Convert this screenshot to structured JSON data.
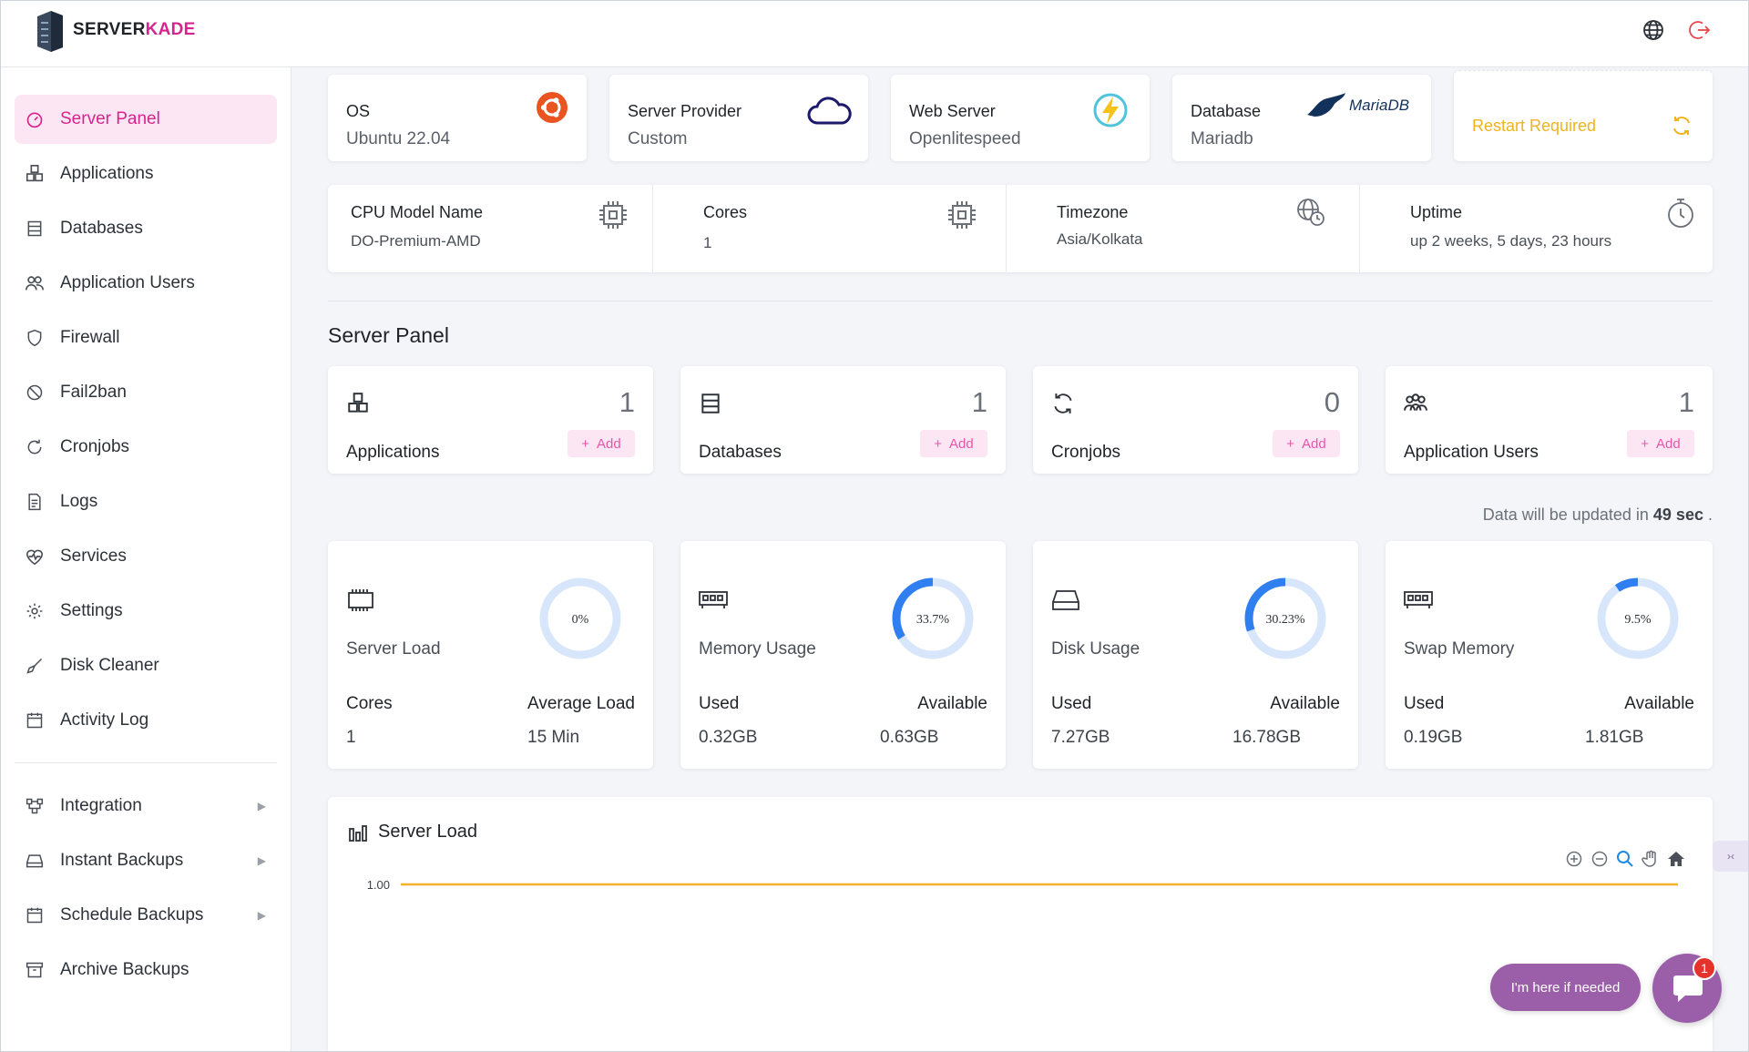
{
  "brand": {
    "part1": "SERVER",
    "part2": "KADE",
    "accent": "#d6248f"
  },
  "header": {
    "icons": [
      "globe-icon",
      "logout-icon"
    ]
  },
  "sidebar": {
    "items": [
      {
        "label": "Server Panel",
        "icon": "speedometer-icon",
        "active": true
      },
      {
        "label": "Applications",
        "icon": "cubes-icon"
      },
      {
        "label": "Databases",
        "icon": "database-icon"
      },
      {
        "label": "Application Users",
        "icon": "users-icon"
      },
      {
        "label": "Firewall",
        "icon": "shield-icon"
      },
      {
        "label": "Fail2ban",
        "icon": "ban-icon"
      },
      {
        "label": "Cronjobs",
        "icon": "refresh-icon"
      },
      {
        "label": "Logs",
        "icon": "document-icon"
      },
      {
        "label": "Services",
        "icon": "heartbeat-icon"
      },
      {
        "label": "Settings",
        "icon": "gear-icon"
      },
      {
        "label": "Disk Cleaner",
        "icon": "broom-icon"
      },
      {
        "label": "Activity Log",
        "icon": "calendar-icon"
      }
    ],
    "lower_items": [
      {
        "label": "Integration",
        "icon": "integration-icon",
        "arrow": "▶"
      },
      {
        "label": "Instant Backups",
        "icon": "drive-icon",
        "arrow": "▶"
      },
      {
        "label": "Schedule Backups",
        "icon": "calendar-icon",
        "arrow": "▶"
      },
      {
        "label": "Archive Backups",
        "icon": "archive-icon"
      }
    ]
  },
  "info_cards": [
    {
      "title": "OS",
      "value": "Ubuntu 22.04",
      "icon": "ubuntu-icon"
    },
    {
      "title": "Server Provider",
      "value": "Custom",
      "icon": "cloud-icon"
    },
    {
      "title": "Web Server",
      "value": "Openlitespeed",
      "icon": "lightning-icon"
    },
    {
      "title": "Database",
      "value": "Mariadb",
      "icon": "mariadb-logo",
      "logo_text": "MariaDB"
    }
  ],
  "restart": {
    "label": "Restart Required",
    "icon": "refresh-icon",
    "color": "#f2b21f"
  },
  "system_info": [
    {
      "title": "CPU Model Name",
      "value": "DO-Premium-AMD",
      "icon": "cpu-icon"
    },
    {
      "title": "Cores",
      "value": "1",
      "icon": "cpu-icon"
    },
    {
      "title": "Timezone",
      "value": "Asia/Kolkata",
      "icon": "globe-clock-icon"
    },
    {
      "title": "Uptime",
      "value": "up 2 weeks, 5 days, 23 hours",
      "icon": "stopwatch-icon"
    }
  ],
  "section_title": "Server Panel",
  "counts": [
    {
      "label": "Applications",
      "count": "1",
      "add": "Add",
      "icon": "cubes-icon"
    },
    {
      "label": "Databases",
      "count": "1",
      "add": "Add",
      "icon": "database-icon"
    },
    {
      "label": "Cronjobs",
      "count": "0",
      "add": "Add",
      "icon": "refresh-icon"
    },
    {
      "label": "Application Users",
      "count": "1",
      "add": "Add",
      "icon": "users-icon"
    }
  ],
  "update_note": {
    "prefix": "Data will be updated in",
    "seconds": "49 sec",
    "suffix": "."
  },
  "usage": [
    {
      "name": "Server Load",
      "percent_label": "0%",
      "percent": 0,
      "k1": "Cores",
      "k2": "Average Load",
      "v1": "1",
      "v2": "15 Min",
      "icon": "chip-icon"
    },
    {
      "name": "Memory Usage",
      "percent_label": "33.7%",
      "percent": 33.7,
      "k1": "Used",
      "k2": "Available",
      "v1": "0.32GB",
      "v2": "0.63GB",
      "icon": "memory-icon"
    },
    {
      "name": "Disk Usage",
      "percent_label": "30.23%",
      "percent": 30.23,
      "k1": "Used",
      "k2": "Available",
      "v1": "7.27GB",
      "v2": "16.78GB",
      "icon": "hdd-icon"
    },
    {
      "name": "Swap Memory",
      "percent_label": "9.5%",
      "percent": 9.5,
      "k1": "Used",
      "k2": "Available",
      "v1": "0.19GB",
      "v2": "1.81GB",
      "icon": "memory-icon"
    }
  ],
  "chart": {
    "title": "Server Load",
    "icon": "bar-chart-icon",
    "tools": [
      "zoom-in-icon",
      "zoom-out-icon",
      "zoom-select-icon",
      "pan-icon",
      "home-icon"
    ]
  },
  "chart_data": {
    "type": "line",
    "title": "Server Load",
    "ytick_labels": [
      "1.00"
    ],
    "series": [
      {
        "values": [
          1,
          1
        ]
      }
    ],
    "line_color": "#f4b429"
  },
  "chat": {
    "prompt": "I'm here if needed",
    "badge": "1",
    "side_tab": "›‹"
  }
}
